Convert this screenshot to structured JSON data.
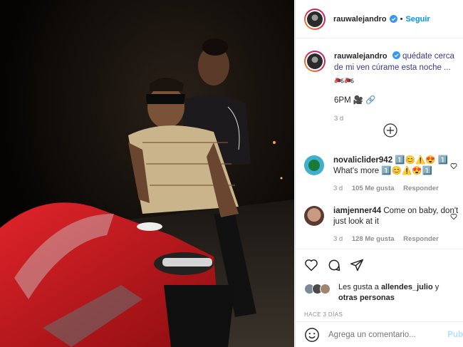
{
  "post": {
    "username": "rauwalejandro",
    "follow_label": "Seguir",
    "separator": "•"
  },
  "caption": {
    "username": "rauwalejandro",
    "text": "quédate cerca de mi ven cúrame esta noche ... 🏍️🏍️",
    "line2": "6PM 🎥 🔗",
    "time": "3 d"
  },
  "comments": [
    {
      "username": "novaliclider942",
      "text": "1️⃣😊⚠️😍 1️⃣ What's more 1️⃣😊⚠️😍1️⃣",
      "time": "3 d",
      "likes": "105 Me gusta",
      "reply": "Responder"
    },
    {
      "username": "iamjenner44",
      "text": "Come on baby, don't just look at it",
      "time": "3 d",
      "likes": "128 Me gusta",
      "reply": "Responder"
    }
  ],
  "likes": {
    "prefix": "Les gusta a ",
    "user": "allendes_julio",
    "middle": " y",
    "others": "otras personas"
  },
  "time_ago": "HACE 3 DÍAS",
  "add_comment": {
    "placeholder": "Agrega un comentario...",
    "publish": "Pub"
  },
  "colors": {
    "accent": "#0095f6",
    "muted": "#8e8e8e",
    "border": "#dbdbdb"
  }
}
